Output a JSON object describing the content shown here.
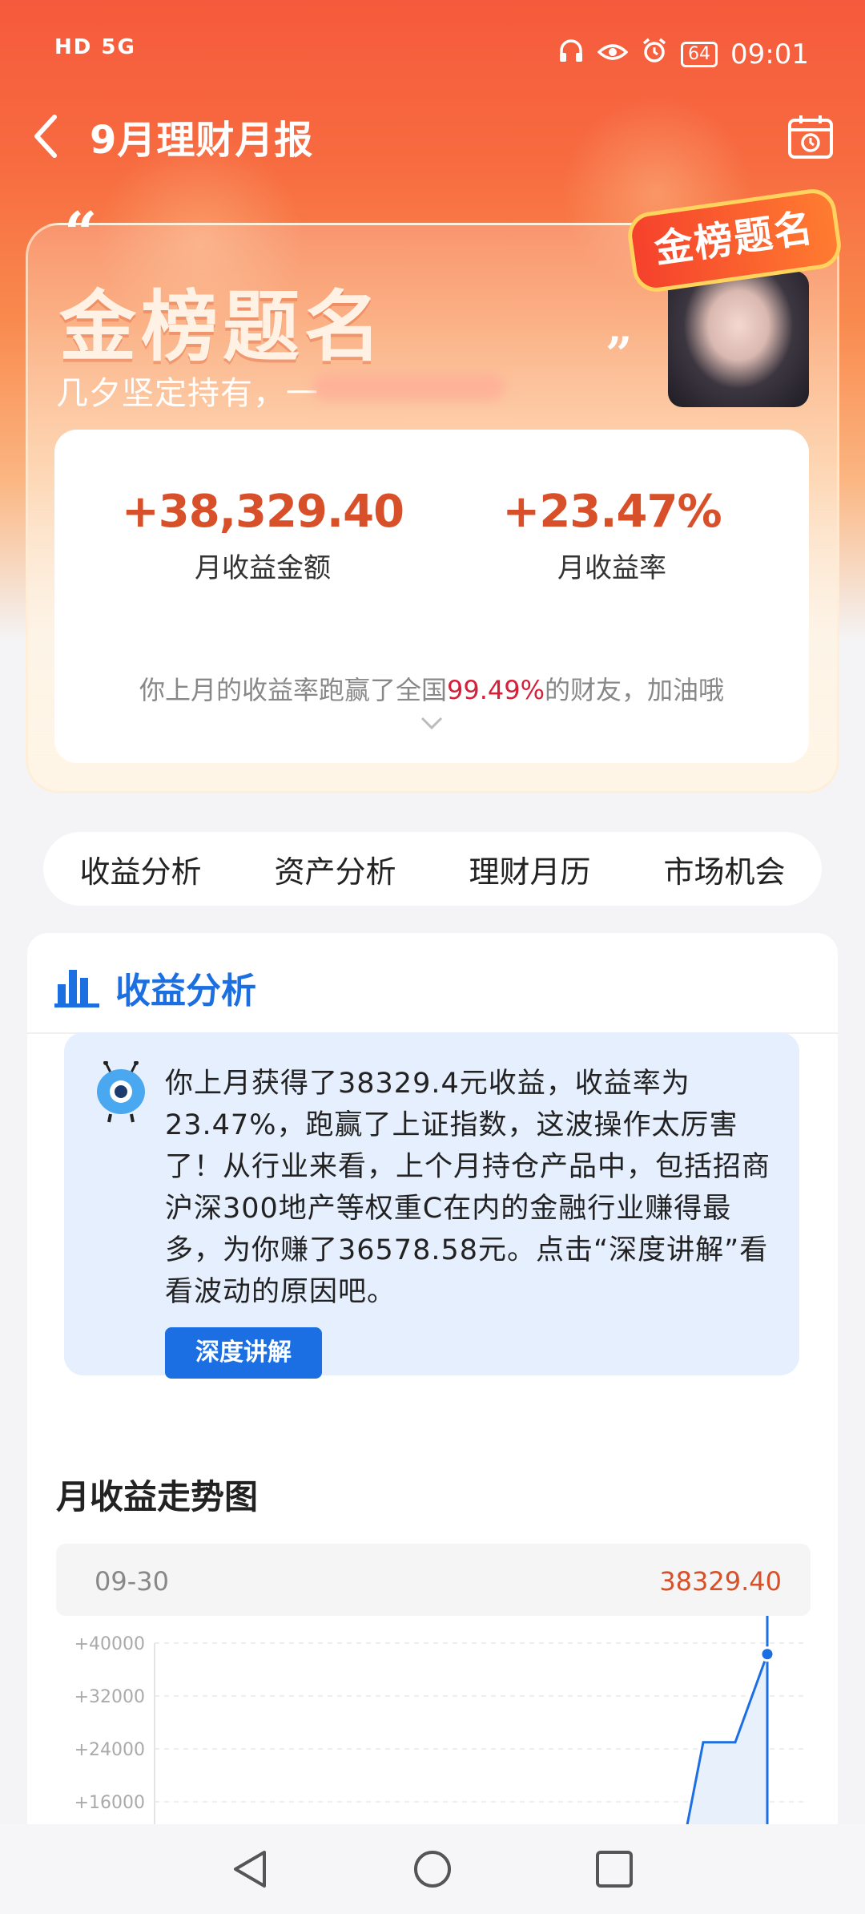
{
  "status_bar": {
    "left": "HD 5G",
    "battery": "64",
    "time": "09:01"
  },
  "header": {
    "title": "9月理财月报"
  },
  "hero": {
    "quote_open": "“",
    "quote_close": "”",
    "title": "金榜题名",
    "subtitle": "几夕坚定持有，一",
    "badge_text": "金榜题名",
    "monthly_profit": "+38,329.40",
    "monthly_profit_label": "月收益金额",
    "monthly_rate": "+23.47%",
    "monthly_rate_label": "月收益率",
    "rank_prefix": "你上月的收益率跑赢了全国",
    "rank_percent": "99.49%",
    "rank_suffix": "的财友，加油哦"
  },
  "tabs": [
    "收益分析",
    "资产分析",
    "理财月历",
    "市场机会"
  ],
  "analysis": {
    "title": "收益分析",
    "note": "你上月获得了38329.4元收益，收益率为23.47%，跑赢了上证指数，这波操作太厉害了！从行业来看，上个月持仓产品中，包括招商沪深300地产等权重C在内的金融行业赚得最多，为你赚了36578.58元。点击“深度讲解”看看波动的原因吧。",
    "button_label": "深度讲解",
    "trend_title": "月收益走势图",
    "tooltip_date": "09-30",
    "tooltip_value": "38329.40"
  },
  "chart_data": {
    "type": "area",
    "y_ticks": [
      "+40000",
      "+32000",
      "+24000",
      "+16000"
    ],
    "ylim": [
      16000,
      40000
    ],
    "series": [
      {
        "values": [
          0,
          0,
          0,
          0,
          0,
          25000,
          25000,
          38329.4
        ]
      }
    ],
    "highlight_value": 38329.4,
    "colors": {
      "line": "#1b6fe3",
      "fill": "#e8f0fc",
      "grid": "#dddddd"
    }
  },
  "colors": {
    "accent": "#1b6fe3",
    "profit": "#d8502a",
    "highlight": "#d6203a"
  }
}
